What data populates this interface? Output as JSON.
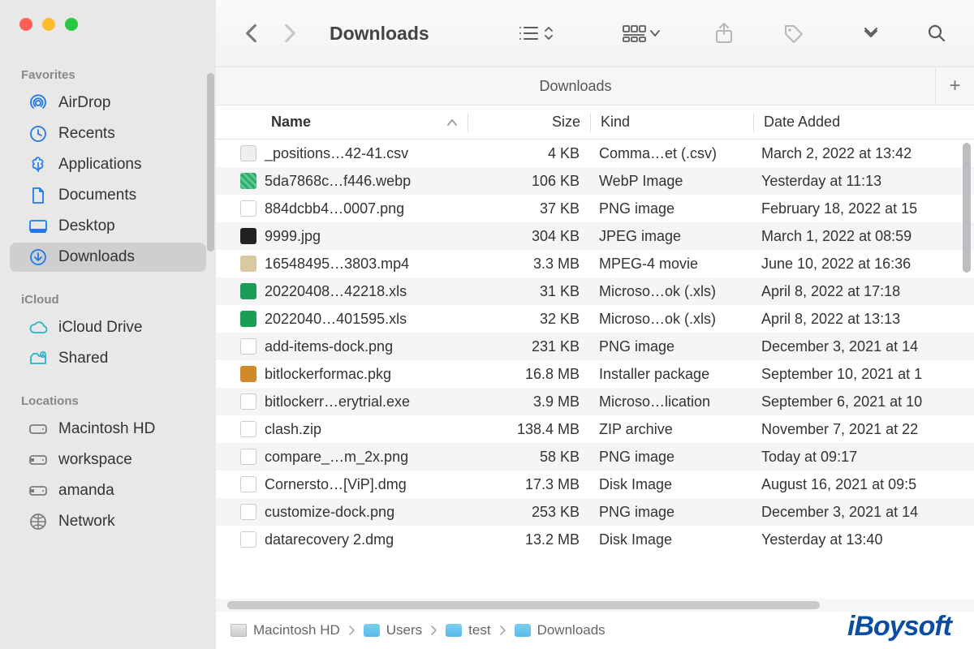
{
  "window": {
    "title": "Downloads"
  },
  "sidebar": {
    "sections": [
      {
        "title": "Favorites",
        "items": [
          {
            "icon": "airdrop",
            "label": "AirDrop",
            "color": "blue"
          },
          {
            "icon": "clock",
            "label": "Recents",
            "color": "blue"
          },
          {
            "icon": "apps",
            "label": "Applications",
            "color": "blue"
          },
          {
            "icon": "doc",
            "label": "Documents",
            "color": "blue"
          },
          {
            "icon": "desktop",
            "label": "Desktop",
            "color": "blue"
          },
          {
            "icon": "download",
            "label": "Downloads",
            "color": "blue",
            "selected": true
          }
        ]
      },
      {
        "title": "iCloud",
        "items": [
          {
            "icon": "cloud",
            "label": "iCloud Drive",
            "color": "teal"
          },
          {
            "icon": "shared",
            "label": "Shared",
            "color": "teal"
          }
        ]
      },
      {
        "title": "Locations",
        "items": [
          {
            "icon": "hdd",
            "label": "Macintosh HD",
            "color": "gray"
          },
          {
            "icon": "ext",
            "label": "workspace",
            "color": "gray"
          },
          {
            "icon": "ext",
            "label": "amanda",
            "color": "gray"
          },
          {
            "icon": "globe",
            "label": "Network",
            "color": "gray"
          }
        ]
      }
    ]
  },
  "tabs": {
    "active": "Downloads"
  },
  "columns": {
    "name": "Name",
    "size": "Size",
    "kind": "Kind",
    "date": "Date Added"
  },
  "files": [
    {
      "icon": "csv",
      "name": "_positions…42-41.csv",
      "size": "4 KB",
      "kind": "Comma…et (.csv)",
      "date": "March 2, 2022 at 13:42"
    },
    {
      "icon": "webp",
      "name": "5da7868c…f446.webp",
      "size": "106 KB",
      "kind": "WebP Image",
      "date": "Yesterday at 11:13"
    },
    {
      "icon": "png",
      "name": "884dcbb4…0007.png",
      "size": "37 KB",
      "kind": "PNG image",
      "date": "February 18, 2022 at 15"
    },
    {
      "icon": "jpg",
      "name": "9999.jpg",
      "size": "304 KB",
      "kind": "JPEG image",
      "date": "March 1, 2022 at 08:59"
    },
    {
      "icon": "mp4",
      "name": "16548495…3803.mp4",
      "size": "3.3 MB",
      "kind": "MPEG-4 movie",
      "date": "June 10, 2022 at 16:36"
    },
    {
      "icon": "xls",
      "name": "20220408…42218.xls",
      "size": "31 KB",
      "kind": "Microso…ok (.xls)",
      "date": "April 8, 2022 at 17:18"
    },
    {
      "icon": "xls",
      "name": "2022040…401595.xls",
      "size": "32 KB",
      "kind": "Microso…ok (.xls)",
      "date": "April 8, 2022 at 13:13"
    },
    {
      "icon": "png",
      "name": "add-items-dock.png",
      "size": "231 KB",
      "kind": "PNG image",
      "date": "December 3, 2021 at 14"
    },
    {
      "icon": "pkg",
      "name": "bitlockerformac.pkg",
      "size": "16.8 MB",
      "kind": "Installer package",
      "date": "September 10, 2021 at 1"
    },
    {
      "icon": "exe",
      "name": "bitlockerr…erytrial.exe",
      "size": "3.9 MB",
      "kind": "Microso…lication",
      "date": "September 6, 2021 at 10"
    },
    {
      "icon": "zip",
      "name": "clash.zip",
      "size": "138.4 MB",
      "kind": "ZIP archive",
      "date": "November 7, 2021 at 22"
    },
    {
      "icon": "png2",
      "name": "compare_…m_2x.png",
      "size": "58 KB",
      "kind": "PNG image",
      "date": "Today at 09:17"
    },
    {
      "icon": "dmg",
      "name": "Cornersto…[ViP].dmg",
      "size": "17.3 MB",
      "kind": "Disk Image",
      "date": "August 16, 2021 at 09:5"
    },
    {
      "icon": "png",
      "name": "customize-dock.png",
      "size": "253 KB",
      "kind": "PNG image",
      "date": "December 3, 2021 at 14"
    },
    {
      "icon": "dmg",
      "name": "datarecovery 2.dmg",
      "size": "13.2 MB",
      "kind": "Disk Image",
      "date": "Yesterday at 13:40"
    }
  ],
  "pathbar": [
    {
      "label": "Macintosh HD",
      "icon": "disk"
    },
    {
      "label": "Users",
      "icon": "folder"
    },
    {
      "label": "test",
      "icon": "folder"
    },
    {
      "label": "Downloads",
      "icon": "folder"
    }
  ],
  "watermark": "iBoysoft"
}
